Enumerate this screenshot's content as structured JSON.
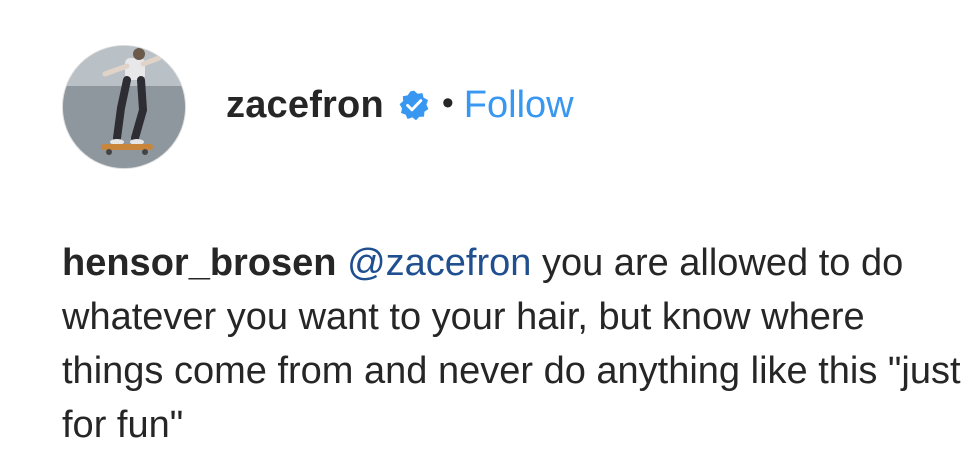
{
  "post_header": {
    "username": "zacefron",
    "verified": true,
    "separator": "•",
    "follow_label": "Follow"
  },
  "comment": {
    "author": "hensor_brosen",
    "mention": "@zacefron",
    "text": "you are allowed to do whatever you want to your hair, but know where things come from and never do anything like this \"just for fun\""
  },
  "colors": {
    "follow": "#3897f0",
    "verified_badge": "#3897f0",
    "mention": "#1f4f8f",
    "text": "#262626"
  },
  "icons": {
    "verified": "verified-badge-icon",
    "avatar": "profile-photo-skateboarder"
  }
}
